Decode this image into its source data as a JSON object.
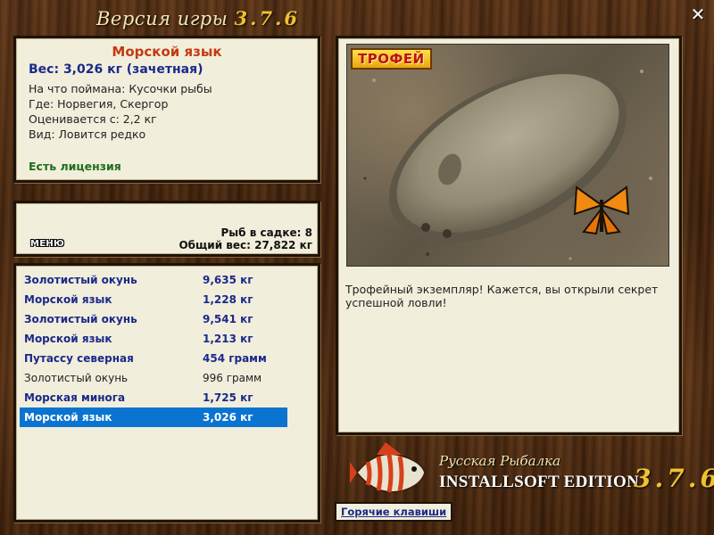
{
  "window": {
    "title_prefix": "Версия игры",
    "title_version": "3.7.6",
    "close_glyph": "✕"
  },
  "fish_info": {
    "name": "Морской язык",
    "weight": "Вес: 3,026 кг (зачетная)",
    "details": [
      "На что поймана: Кусочки рыбы",
      "Где: Норвегия, Скергор",
      "Оценивается с: 2,2 кг",
      "Вид: Ловится редко"
    ],
    "license": "Есть лицензия"
  },
  "cage": {
    "menu_label": "МЕНЮ",
    "count": "Рыб в садке: 8",
    "total_weight": "Общий вес: 27,822 кг"
  },
  "catch_list": [
    {
      "name": "Золотистый окунь",
      "weight": "9,635 кг",
      "style": "bold"
    },
    {
      "name": "Морской язык",
      "weight": "1,228 кг",
      "style": "bold"
    },
    {
      "name": "Золотистый окунь",
      "weight": "9,541 кг",
      "style": "bold"
    },
    {
      "name": "Морской язык",
      "weight": "1,213 кг",
      "style": "bold"
    },
    {
      "name": "Путассу северная",
      "weight": "454 грамм",
      "style": "bold"
    },
    {
      "name": "Золотистый окунь",
      "weight": "996 грамм",
      "style": "plain"
    },
    {
      "name": "Морская минога",
      "weight": "1,725 кг",
      "style": "bold"
    },
    {
      "name": "Морской язык",
      "weight": "3,026 кг",
      "style": "selected"
    }
  ],
  "trophy": {
    "badge": "ТРОФЕЙ",
    "message": "Трофейный экземпляр! Кажется, вы открыли секрет успешной ловли!"
  },
  "brand": {
    "line1": "Русская Рыбалка",
    "line2": "INSTALLSOFT EDITION",
    "version": "3.7.6"
  },
  "hotkeys_label": "Горячие клавиши",
  "colors": {
    "accent_red": "#c43a10",
    "accent_blue": "#1a2a8a",
    "selection": "#0a74d0",
    "license_green": "#1f6e1a",
    "gold": "#f0c030"
  }
}
